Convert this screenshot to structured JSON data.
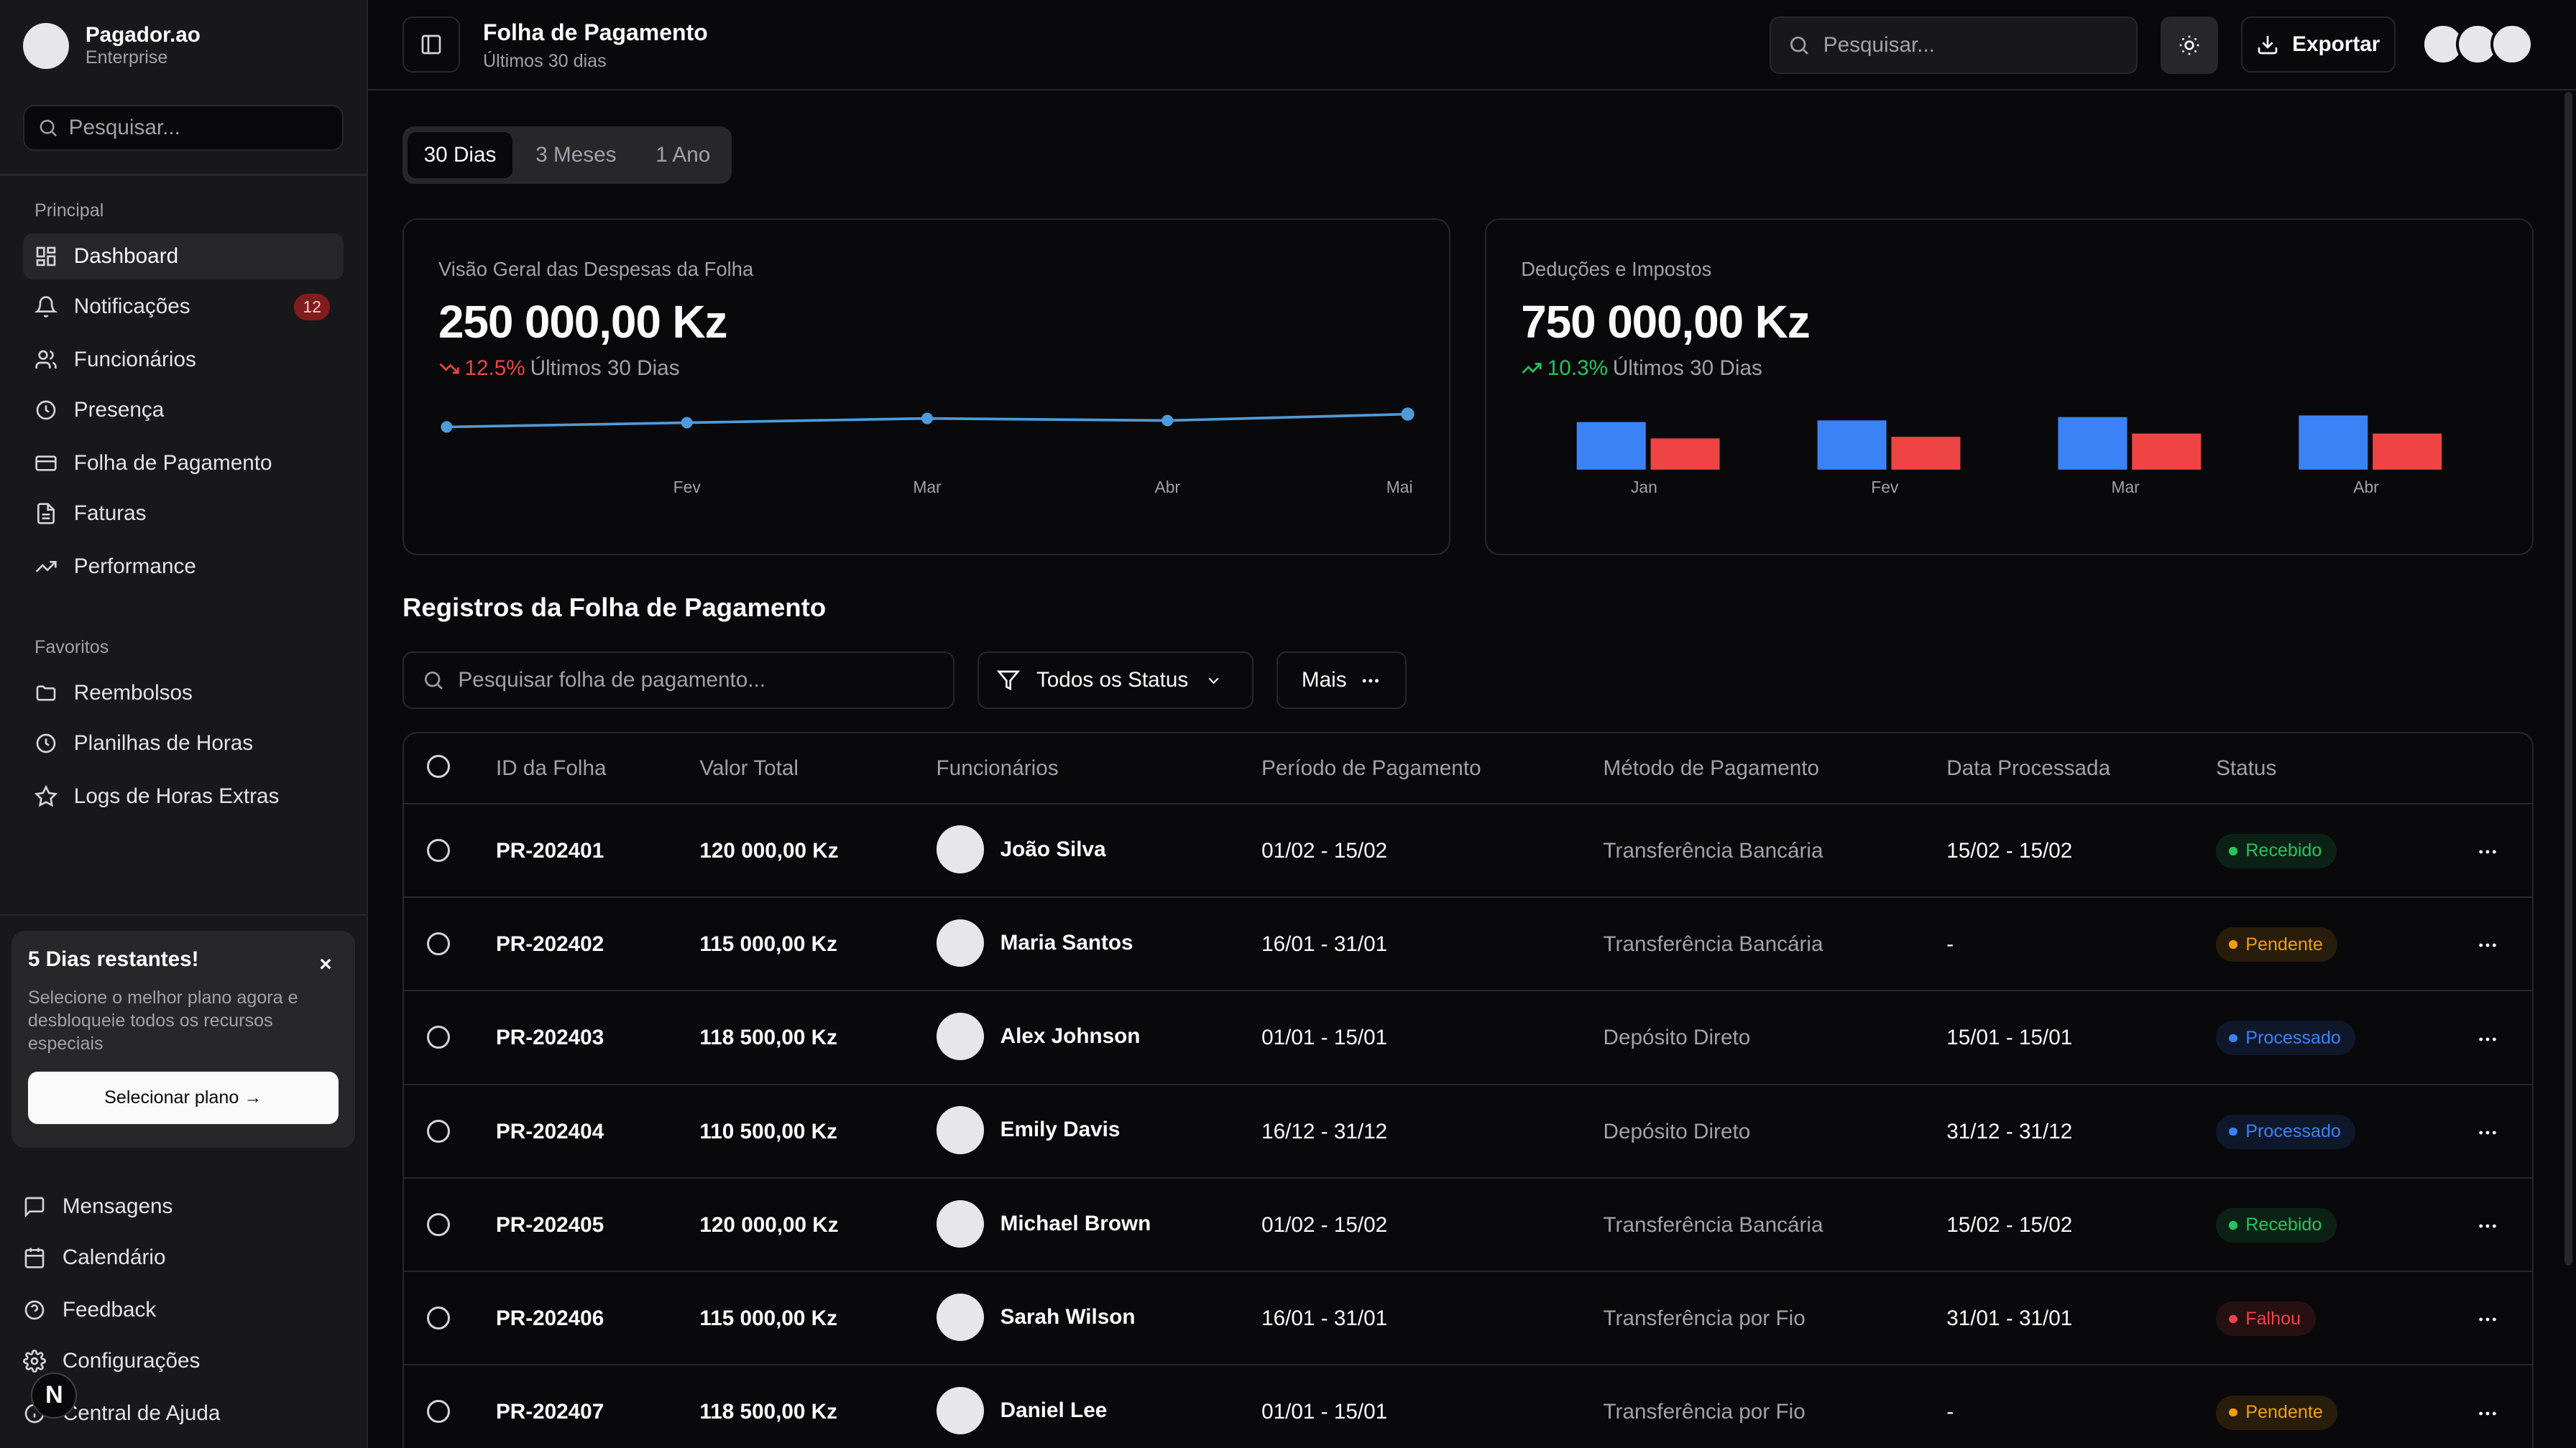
{
  "brand": {
    "name": "Pagador.ao",
    "plan": "Enterprise"
  },
  "sidebar": {
    "search_placeholder": "Pesquisar...",
    "section_main": "Principal",
    "main_items": [
      {
        "label": "Dashboard",
        "icon": "dashboard-icon"
      },
      {
        "label": "Notificações",
        "icon": "bell-icon",
        "badge": "12"
      },
      {
        "label": "Funcionários",
        "icon": "users-icon"
      },
      {
        "label": "Presença",
        "icon": "clock-icon"
      },
      {
        "label": "Folha de Pagamento",
        "icon": "credit-card-icon"
      },
      {
        "label": "Faturas",
        "icon": "file-icon"
      },
      {
        "label": "Performance",
        "icon": "trending-up-icon"
      }
    ],
    "section_favorites": "Favoritos",
    "favorite_items": [
      {
        "label": "Reembolsos",
        "icon": "folder-icon"
      },
      {
        "label": "Planilhas de Horas",
        "icon": "clock-icon"
      },
      {
        "label": "Logs de Horas Extras",
        "icon": "star-icon"
      }
    ],
    "trial": {
      "title": "5 Dias restantes!",
      "description": "Selecione o melhor plano agora e desbloqueie todos os recursos especiais",
      "button": "Selecionar plano →",
      "close": "×"
    },
    "bottom_items": [
      {
        "label": "Mensagens",
        "icon": "message-icon"
      },
      {
        "label": "Calendário",
        "icon": "calendar-icon"
      },
      {
        "label": "Feedback",
        "icon": "help-circle-icon"
      },
      {
        "label": "Configurações",
        "icon": "gear-icon"
      },
      {
        "label": "Central de Ajuda",
        "icon": "help-icon"
      }
    ],
    "bubble": "N"
  },
  "header": {
    "title": "Folha de Pagamento",
    "subtitle": "Últimos 30 dias",
    "search_placeholder": "Pesquisar...",
    "export_label": "Exportar"
  },
  "range_tabs": [
    "30 Dias",
    "3 Meses",
    "1 Ano"
  ],
  "range_selected": "30 Dias",
  "cards": {
    "expenses": {
      "label": "Visão Geral das Despesas da Folha",
      "value": "250 000,00 Kz",
      "change": "12.5%",
      "period": "Últimos 30 Dias",
      "direction": "down"
    },
    "deductions": {
      "label": "Deduções e Impostos",
      "value": "750 000,00 Kz",
      "change": "10.3%",
      "period": "Últimos 30 Dias",
      "direction": "up"
    }
  },
  "chart_data": [
    {
      "type": "line",
      "categories": [
        "",
        "Fev",
        "Mar",
        "Abr",
        "Mai"
      ],
      "series": [
        {
          "values": [
            40,
            42,
            44,
            43,
            46
          ]
        }
      ],
      "ylim": [
        0,
        60
      ],
      "grid": false,
      "color": "#4f9bd9"
    },
    {
      "type": "bar",
      "categories": [
        "Jan",
        "Fev",
        "Mar",
        "Abr"
      ],
      "series": [
        {
          "values": [
            29,
            30,
            32,
            33
          ],
          "color": "#3b82f6"
        },
        {
          "values": [
            19,
            20,
            22,
            22
          ],
          "color": "#ef4444"
        }
      ],
      "ylim": [
        0,
        36
      ],
      "grid": false
    }
  ],
  "records": {
    "title": "Registros da Folha de Pagamento",
    "search_placeholder": "Pesquisar folha de pagamento...",
    "filter_label": "Todos os Status",
    "more_label": "Mais",
    "columns": [
      "ID da Folha",
      "Valor Total",
      "Funcionários",
      "Período de Pagamento",
      "Método de Pagamento",
      "Data Processada",
      "Status"
    ],
    "rows": [
      {
        "id": "PR-202401",
        "total": "120 000,00 Kz",
        "employee": "João Silva",
        "period": "01/02 - 15/02",
        "method": "Transferência Bancária",
        "processed": "15/02 - 15/02",
        "status": "Recebido",
        "status_color": "#22c55e"
      },
      {
        "id": "PR-202402",
        "total": "115 000,00 Kz",
        "employee": "Maria Santos",
        "period": "16/01 - 31/01",
        "method": "Transferência Bancária",
        "processed": "-",
        "status": "Pendente",
        "status_color": "#f59e0b"
      },
      {
        "id": "PR-202403",
        "total": "118 500,00 Kz",
        "employee": "Alex Johnson",
        "period": "01/01 - 15/01",
        "method": "Depósito Direto",
        "processed": "15/01 - 15/01",
        "status": "Processado",
        "status_color": "#3b82f6"
      },
      {
        "id": "PR-202404",
        "total": "110 500,00 Kz",
        "employee": "Emily Davis",
        "period": "16/12 - 31/12",
        "method": "Depósito Direto",
        "processed": "31/12 - 31/12",
        "status": "Processado",
        "status_color": "#3b82f6"
      },
      {
        "id": "PR-202405",
        "total": "120 000,00 Kz",
        "employee": "Michael Brown",
        "period": "01/02 - 15/02",
        "method": "Transferência Bancária",
        "processed": "15/02 - 15/02",
        "status": "Recebido",
        "status_color": "#22c55e"
      },
      {
        "id": "PR-202406",
        "total": "115 000,00 Kz",
        "employee": "Sarah Wilson",
        "period": "16/01 - 31/01",
        "method": "Transferência por Fio",
        "processed": "31/01 - 31/01",
        "status": "Falhou",
        "status_color": "#ef4444"
      },
      {
        "id": "PR-202407",
        "total": "118 500,00 Kz",
        "employee": "Daniel Lee",
        "period": "01/01 - 15/01",
        "method": "Transferência por Fio",
        "processed": "-",
        "status": "Pendente",
        "status_color": "#f59e0b"
      }
    ]
  },
  "colors": {
    "background": "#09090b",
    "sidebar": "#18181b",
    "border": "#27272a",
    "trend_down": "#ef4444",
    "trend_up": "#22c55e"
  }
}
